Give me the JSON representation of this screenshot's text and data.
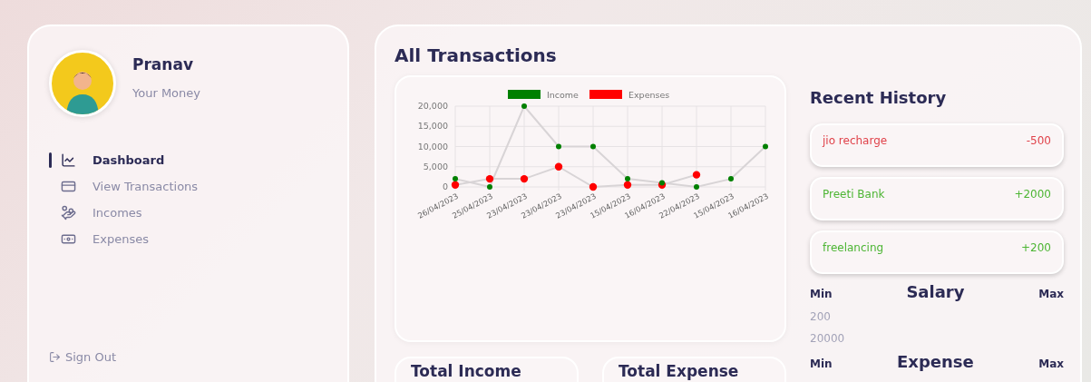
{
  "profile": {
    "name": "Pranav",
    "subtitle": "Your Money"
  },
  "nav": [
    {
      "label": "Dashboard",
      "selected": true
    },
    {
      "label": "View Transactions",
      "selected": false
    },
    {
      "label": "Incomes",
      "selected": false
    },
    {
      "label": "Expenses",
      "selected": false
    }
  ],
  "sign_out": "Sign Out",
  "main": {
    "title": "All Transactions",
    "chart_data": {
      "type": "line",
      "categories": [
        "26/04/2023",
        "25/04/2023",
        "23/04/2023",
        "23/04/2023",
        "23/04/2023",
        "15/04/2023",
        "16/04/2023",
        "22/04/2023",
        "15/04/2023",
        "16/04/2023"
      ],
      "grid": true,
      "legend": true,
      "ylim": [
        0,
        20000
      ],
      "yticks": [
        {
          "value": 0,
          "label": "0"
        },
        {
          "value": 5000,
          "label": "5,000"
        },
        {
          "value": 10000,
          "label": "10,000"
        },
        {
          "value": 15000,
          "label": "15,000"
        },
        {
          "value": 20000,
          "label": "20,000"
        }
      ],
      "series": [
        {
          "name": "Income",
          "color": "#008000",
          "marker": "circle",
          "values": [
            2000,
            0,
            20000,
            10000,
            10000,
            2000,
            1000,
            0,
            2000,
            10000
          ]
        },
        {
          "name": "Expenses",
          "color": "#ff0000",
          "marker": "circle",
          "values": [
            500,
            2000,
            2000,
            5000,
            0,
            500,
            500,
            3000,
            null,
            null
          ]
        }
      ]
    },
    "summary_cards": [
      {
        "title": "Total Income"
      },
      {
        "title": "Total Expense"
      }
    ]
  },
  "recent_history": {
    "title": "Recent History",
    "items": [
      {
        "kind": "expense",
        "name": "jio recharge",
        "amount": "-500"
      },
      {
        "kind": "income",
        "name": "Preeti Bank",
        "amount": "+2000"
      },
      {
        "kind": "income",
        "name": "freelancing",
        "amount": "+200"
      }
    ]
  },
  "ranges": [
    {
      "min_label": "Min",
      "title": "Salary",
      "max_label": "Max",
      "min_value": "200",
      "max_value": "20000"
    },
    {
      "min_label": "Min",
      "title": "Expense",
      "max_label": "Max"
    }
  ]
}
